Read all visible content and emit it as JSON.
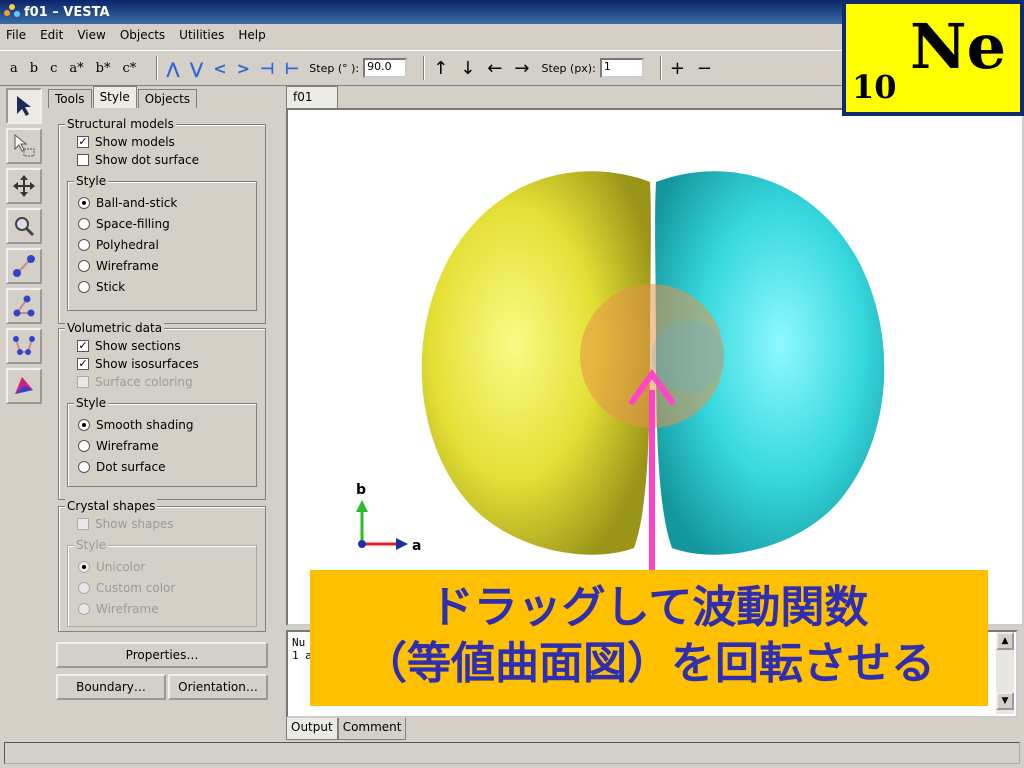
{
  "window": {
    "title": "f01 – VESTA"
  },
  "menu": [
    "File",
    "Edit",
    "View",
    "Objects",
    "Utilities",
    "Help"
  ],
  "toolbar": {
    "axes": [
      "a",
      "b",
      "c",
      "a*",
      "b*",
      "c*"
    ],
    "step_deg_label": "Step (° ):",
    "step_deg_value": "90.0",
    "step_px_label": "Step (px):",
    "step_px_value": "1",
    "plus": "+",
    "minus": "−"
  },
  "panel": {
    "tabs": [
      "Tools",
      "Style",
      "Objects"
    ],
    "active_tab": "Style",
    "structural": {
      "title": "Structural models",
      "show_models": "Show models",
      "show_dot_surface": "Show dot surface",
      "style_title": "Style",
      "styles": [
        "Ball-and-stick",
        "Space-filling",
        "Polyhedral",
        "Wireframe",
        "Stick"
      ]
    },
    "volumetric": {
      "title": "Volumetric data",
      "show_sections": "Show sections",
      "show_isosurfaces": "Show isosurfaces",
      "surface_coloring": "Surface coloring",
      "style_title": "Style",
      "styles": [
        "Smooth shading",
        "Wireframe",
        "Dot surface"
      ]
    },
    "crystal": {
      "title": "Crystal shapes",
      "show_shapes": "Show shapes",
      "style_title": "Style",
      "styles": [
        "Unicolor",
        "Custom color",
        "Wireframe"
      ]
    },
    "properties_btn": "Properties…",
    "boundary_btn": "Boundary…",
    "orientation_btn": "Orientation…"
  },
  "viewer": {
    "tab": "f01",
    "axis_a": "a",
    "axis_b": "b",
    "colors": {
      "lobe_left": "#e6e236",
      "lobe_right": "#38d6dc",
      "core": "#e8914a",
      "arrow": "#ff44cc"
    }
  },
  "output": {
    "line1": "Nu",
    "line2": "1 a",
    "tabs": [
      "Output",
      "Comment"
    ]
  },
  "badge": {
    "subscript": "10",
    "symbol": "Ne"
  },
  "callout": {
    "line1": "ドラッグして波動関数",
    "line2": "（等値曲面図）を回転させる"
  }
}
